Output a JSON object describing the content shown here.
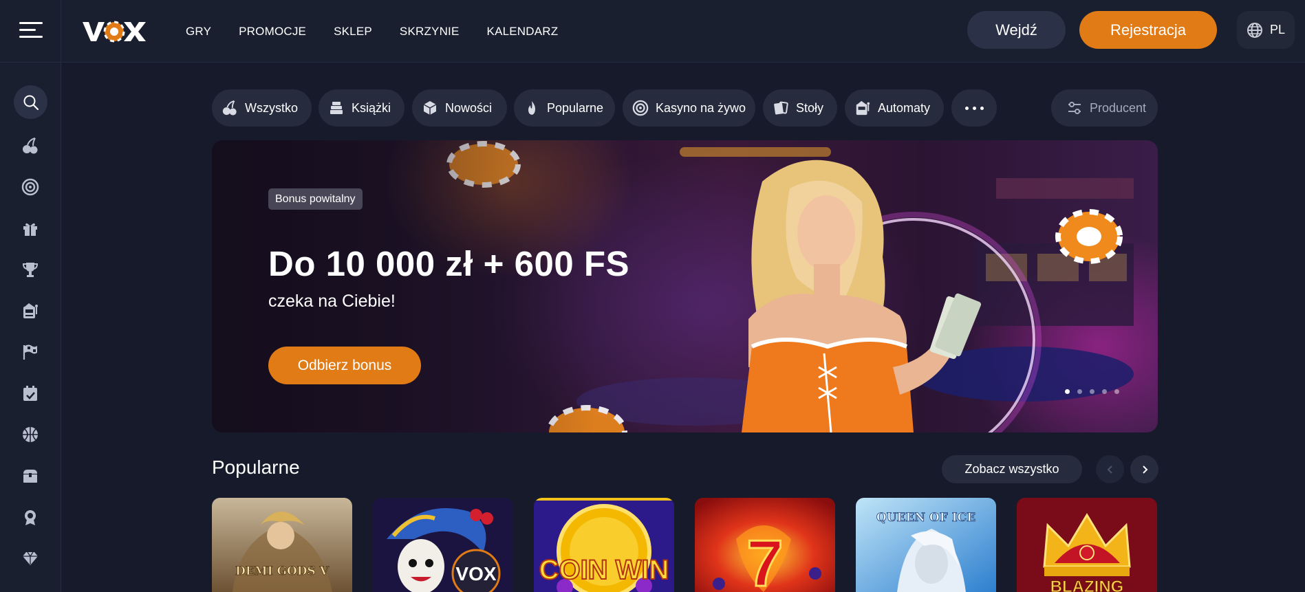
{
  "header": {
    "logo_text": "VOX",
    "nav": [
      "GRY",
      "PROMOCJE",
      "SKLEP",
      "SKRZYNIE",
      "KALENDARZ"
    ],
    "login_label": "Wejdź",
    "register_label": "Rejestracja",
    "language": "PL"
  },
  "sidebar": {
    "icons": [
      "search-icon",
      "cherries-icon",
      "roulette-icon",
      "gift-icon",
      "trophy-icon",
      "slot-machine-icon",
      "race-flag-icon",
      "calendar-check-icon",
      "sport-ball-icon",
      "treasure-chest-icon",
      "badge-icon",
      "diamond-icon"
    ]
  },
  "tabs": [
    {
      "label": "Wszystko",
      "icon": "cherries-icon"
    },
    {
      "label": "Książki",
      "icon": "books-icon"
    },
    {
      "label": "Nowości",
      "icon": "cube-icon"
    },
    {
      "label": "Popularne",
      "icon": "flame-icon"
    },
    {
      "label": "Kasyno na żywo",
      "icon": "chip-icon"
    },
    {
      "label": "Stoły",
      "icon": "cards-icon"
    },
    {
      "label": "Automaty",
      "icon": "slot-machine-icon"
    }
  ],
  "producer_label": "Producent",
  "hero": {
    "badge": "Bonus powitalny",
    "title": "Do 10 000 zł + 600 FS",
    "subtitle": "czeka na Ciebie!",
    "cta": "Odbierz bonus",
    "slides": 5,
    "active_slide": 1
  },
  "popular": {
    "title": "Popularne",
    "see_all": "Zobacz wszystko",
    "games": [
      {
        "name": "DEMI GODS V",
        "label": "DEMI GODS V"
      },
      {
        "name": "VOX joker",
        "label": "VOX"
      },
      {
        "name": "COIN WIN",
        "label": "COIN WIN"
      },
      {
        "name": "Lucky 7",
        "label": "7"
      },
      {
        "name": "QUEEN OF ICE",
        "label": "QUEEN OF ICE"
      },
      {
        "name": "Blazing crown",
        "label": "BLAZING"
      }
    ]
  },
  "colors": {
    "accent": "#e07b16",
    "background": "#161a2a",
    "panel": "#1a1f30",
    "chip": "#262b3e"
  }
}
